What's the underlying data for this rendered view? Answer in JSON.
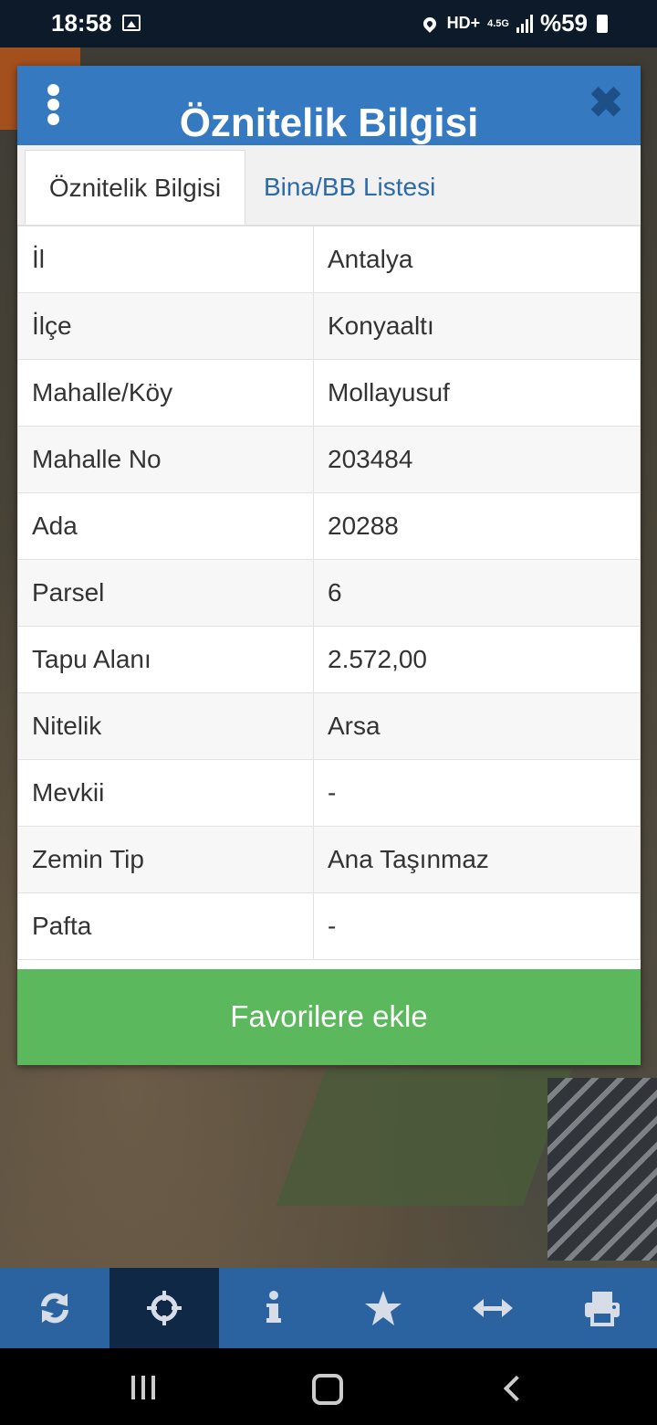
{
  "status_bar": {
    "time": "18:58",
    "network": "HD+",
    "network_type": "4.5G",
    "battery": "%59"
  },
  "dialog": {
    "title": "Öznitelik Bilgisi",
    "tabs": [
      {
        "label": "Öznitelik Bilgisi",
        "active": true
      },
      {
        "label": "Bina/BB Listesi",
        "active": false
      }
    ],
    "rows": [
      {
        "key": "İl",
        "value": "Antalya"
      },
      {
        "key": "İlçe",
        "value": "Konyaaltı"
      },
      {
        "key": "Mahalle/Köy",
        "value": "Mollayusuf"
      },
      {
        "key": "Mahalle No",
        "value": "203484"
      },
      {
        "key": "Ada",
        "value": "20288"
      },
      {
        "key": "Parsel",
        "value": "6"
      },
      {
        "key": "Tapu Alanı",
        "value": "2.572,00"
      },
      {
        "key": "Nitelik",
        "value": "Arsa"
      },
      {
        "key": "Mevkii",
        "value": "-"
      },
      {
        "key": "Zemin Tip",
        "value": "Ana Taşınmaz"
      },
      {
        "key": "Pafta",
        "value": "-"
      }
    ],
    "favorite_button": "Favorilere ekle"
  },
  "toolbar": {
    "items": [
      {
        "icon": "refresh-icon"
      },
      {
        "icon": "crosshair-icon",
        "active": true
      },
      {
        "icon": "info-icon"
      },
      {
        "icon": "star-icon"
      },
      {
        "icon": "measure-icon"
      },
      {
        "icon": "print-icon"
      }
    ]
  },
  "colors": {
    "header": "#3579c0",
    "accent_button": "#5cb85c",
    "toolbar": "#2b62a0",
    "toolbar_active": "#0f2846"
  }
}
